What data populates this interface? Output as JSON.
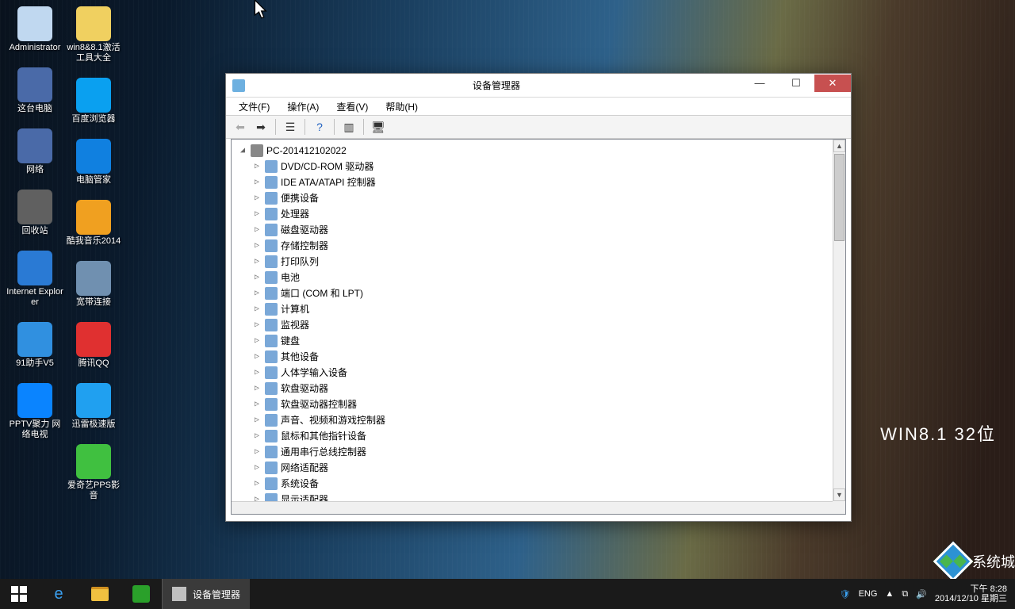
{
  "wallpaper": {
    "brand_text": "WIN8.1  32位",
    "site_text": "系统城"
  },
  "desktop": {
    "col1": [
      {
        "label": "Administrator",
        "color": "#c0d8f0"
      },
      {
        "label": "这台电脑",
        "color": "#4a6aa8"
      },
      {
        "label": "网络",
        "color": "#4a6aa8"
      },
      {
        "label": "回收站",
        "color": "#606060"
      },
      {
        "label": "Internet Explorer",
        "color": "#2a7ad4"
      },
      {
        "label": "91助手V5",
        "color": "#3090e0"
      },
      {
        "label": "PPTV聚力 网络电视",
        "color": "#0a84ff"
      }
    ],
    "col2": [
      {
        "label": "win8&8.1激活工具大全",
        "color": "#f0d060"
      },
      {
        "label": "百度浏览器",
        "color": "#0aa0f0"
      },
      {
        "label": "电脑管家",
        "color": "#1080e0"
      },
      {
        "label": "酷我音乐2014",
        "color": "#f0a020"
      },
      {
        "label": "宽带连接",
        "color": "#7090b0"
      },
      {
        "label": "腾讯QQ",
        "color": "#e03030"
      },
      {
        "label": "迅雷极速版",
        "color": "#20a0f0"
      }
    ],
    "col3": [
      {
        "label": "爱奇艺PPS影音",
        "color": "#40c040"
      }
    ]
  },
  "window": {
    "title": "设备管理器",
    "menu": {
      "file": "文件(F)",
      "action": "操作(A)",
      "view": "查看(V)",
      "help": "帮助(H)"
    },
    "root": "PC-201412102022",
    "categories": [
      "DVD/CD-ROM 驱动器",
      "IDE ATA/ATAPI 控制器",
      "便携设备",
      "处理器",
      "磁盘驱动器",
      "存储控制器",
      "打印队列",
      "电池",
      "端口 (COM 和 LPT)",
      "计算机",
      "监视器",
      "键盘",
      "其他设备",
      "人体学输入设备",
      "软盘驱动器",
      "软盘驱动器控制器",
      "声音、视频和游戏控制器",
      "鼠标和其他指针设备",
      "通用串行总线控制器",
      "网络适配器",
      "系统设备",
      "显示适配器"
    ]
  },
  "taskbar": {
    "task_label": "设备管理器",
    "lang": "ENG",
    "time": "下午 8:28",
    "date": "2014/12/10 星期三"
  }
}
